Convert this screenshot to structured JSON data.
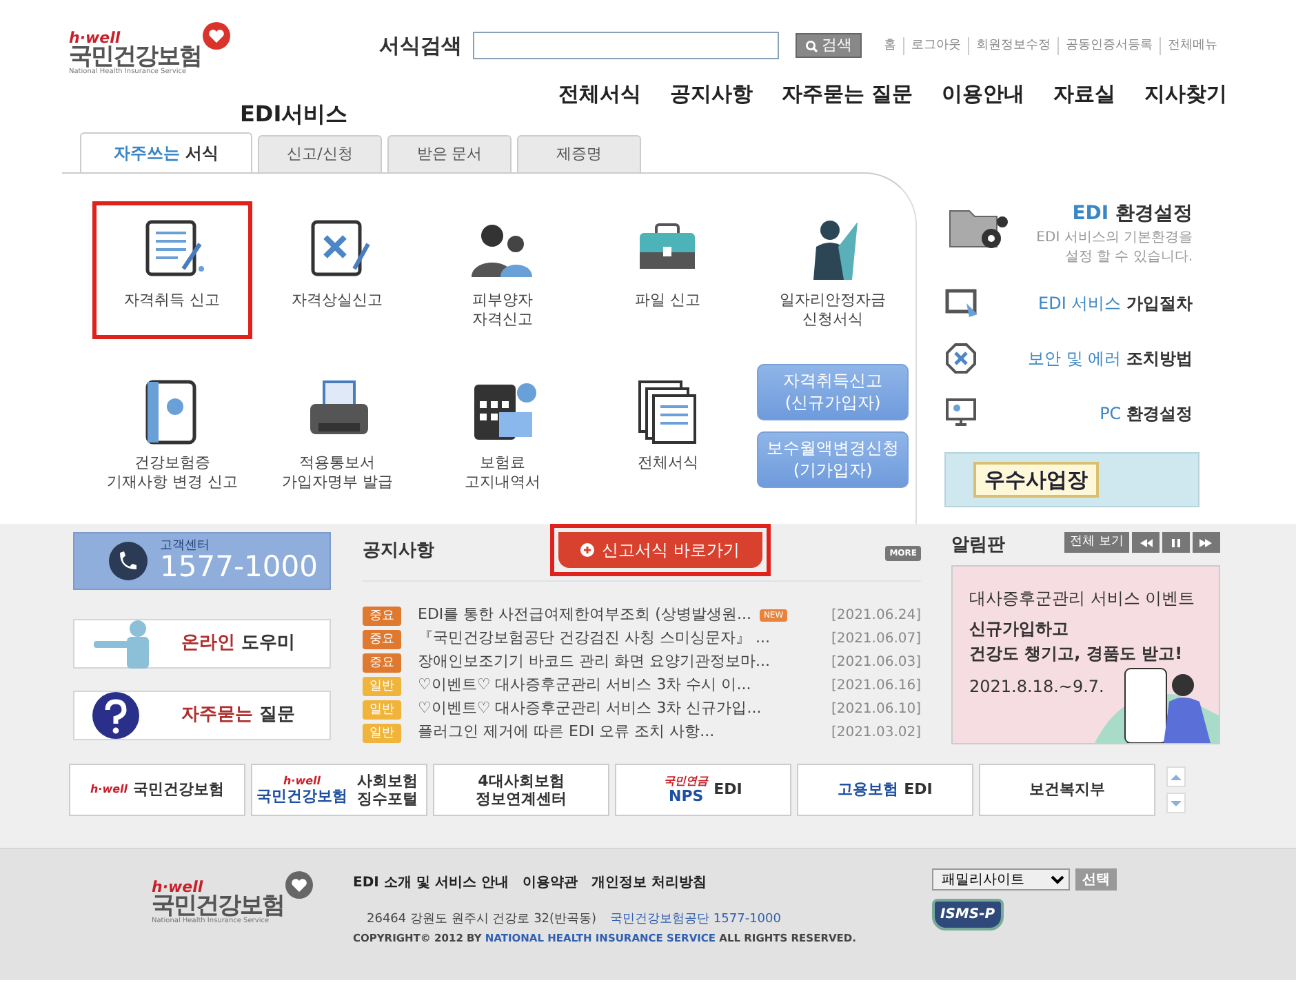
{
  "header": {
    "logo": {
      "tag": "h·well",
      "name": "국민건강보험",
      "subtitle": "National Health Insurance Service"
    },
    "service": {
      "accent": "EDI",
      "label": "서비스"
    },
    "search": {
      "label": "서식검색",
      "button": "검색"
    },
    "util_links": [
      "홈",
      "로그아웃",
      "회원정보수정",
      "공동인증서등록",
      "전체메뉴"
    ],
    "nav": [
      "전체서식",
      "공지사항",
      "자주묻는 질문",
      "이용안내",
      "자료실",
      "지사찾기"
    ]
  },
  "tabs": [
    {
      "accent": "자주쓰는",
      "label": "서식",
      "selected": true
    },
    {
      "label": "신고/신청",
      "selected": false
    },
    {
      "label": "받은 문서",
      "selected": false
    },
    {
      "label": "제증명",
      "selected": false
    }
  ],
  "forms": [
    {
      "lines": [
        "자격취득 신고"
      ],
      "highlighted": true
    },
    {
      "lines": [
        "자격상실신고"
      ],
      "highlighted": false
    },
    {
      "lines": [
        "피부양자",
        "자격신고"
      ],
      "highlighted": false
    },
    {
      "lines": [
        "파일 신고"
      ],
      "highlighted": false
    },
    {
      "lines": [
        "일자리안정자금",
        "신청서식"
      ],
      "highlighted": false
    },
    {
      "lines": [
        "건강보험증",
        "기재사항 변경 신고"
      ],
      "highlighted": false
    },
    {
      "lines": [
        "적용통보서",
        "가입자명부 발급"
      ],
      "highlighted": false
    },
    {
      "lines": [
        "보험료",
        "고지내역서"
      ],
      "highlighted": false
    },
    {
      "lines": [
        "전체서식"
      ],
      "highlighted": false
    }
  ],
  "quick_buttons": [
    {
      "lines": [
        "자격취득신고",
        "(신규가입자)"
      ]
    },
    {
      "lines": [
        "보수월액변경신청",
        "(기가입자)"
      ]
    }
  ],
  "settings": {
    "accent": "EDI",
    "title": "환경설정",
    "desc": [
      "EDI 서비스의 기본환경을",
      "설정 할 수 있습니다."
    ]
  },
  "guide_links": [
    {
      "accent": "EDI 서비스",
      "label": "가입절차"
    },
    {
      "accent": "보안 및 에러",
      "label": "조치방법"
    },
    {
      "accent": "PC",
      "label": "환경설정"
    }
  ],
  "award_banner": "우수사업장",
  "customer_center": {
    "label": "고객센터",
    "phone": "1577-1000"
  },
  "helpers": [
    {
      "accent": "온라인",
      "label": "도우미"
    },
    {
      "accent": "자주묻는",
      "label": "질문"
    }
  ],
  "notices": {
    "title": "공지사항",
    "shortcut": {
      "label": "신고서식 바로가기",
      "highlighted": true
    },
    "more": "MORE",
    "rows": [
      {
        "kind": "important",
        "tag": "중요",
        "title": "EDI를 통한 사전급여제한여부조회 (상병발생원...",
        "badge": "NEW",
        "date": "[2021.06.24]"
      },
      {
        "kind": "important",
        "tag": "중요",
        "title": "『국민건강보험공단 건강검진 사칭 스미싱문자』 ...",
        "date": "[2021.06.07]"
      },
      {
        "kind": "important",
        "tag": "중요",
        "title": "장애인보조기기 바코드 관리 화면 요양기관정보마...",
        "date": "[2021.06.03]"
      },
      {
        "kind": "general",
        "tag": "일반",
        "title": "♡이벤트♡ 대사증후군관리 서비스 3차 수시 이...",
        "date": "[2021.06.16]"
      },
      {
        "kind": "general",
        "tag": "일반",
        "title": "♡이벤트♡ 대사증후군관리 서비스 3차 신규가입...",
        "date": "[2021.06.10]"
      },
      {
        "kind": "general",
        "tag": "일반",
        "title": "플러그인 제거에 따른 EDI 오류 조치 사항...",
        "date": "[2021.03.02]"
      }
    ]
  },
  "board": {
    "title": "알림판",
    "view_all": "전체 보기",
    "banner": {
      "subtitle": "대사증후군관리 서비스 이벤트",
      "headline": [
        "신규가입하고",
        "건강도 챙기고, 경품도 받고!"
      ],
      "period": "2021.8.18.~9.7."
    }
  },
  "partners": [
    {
      "tag": "h·well",
      "label": "국민건강보험"
    },
    {
      "tag": "h·well",
      "brand": "국민건강보험",
      "label": "사회보험 징수포털"
    },
    {
      "label": "4대사회보험 정보연계센터"
    },
    {
      "brand": "NPS",
      "tag": "국민연금",
      "label": "EDI"
    },
    {
      "brand": "고용보험",
      "label": "EDI"
    },
    {
      "label": "보건복지부"
    }
  ],
  "footer": {
    "logo": {
      "tag": "h·well",
      "name": "국민건강보험",
      "subtitle": "National Health Insurance Service"
    },
    "links": [
      "EDI 소개 및 서비스 안내",
      "이용약관",
      "개인정보 처리방침"
    ],
    "address": "26464  강원도 원주시 건강로 32(반곡동)",
    "contact": "국민건강보험공단 1577-1000",
    "copyright": "COPYRIGHT© 2012 BY **NATIONAL HEALTH INSURANCE SERVICE** ALL RIGHTS RESERVED.",
    "family_site": "패밀리사이트",
    "select_button": "선택",
    "cert": "ISMS-P"
  }
}
